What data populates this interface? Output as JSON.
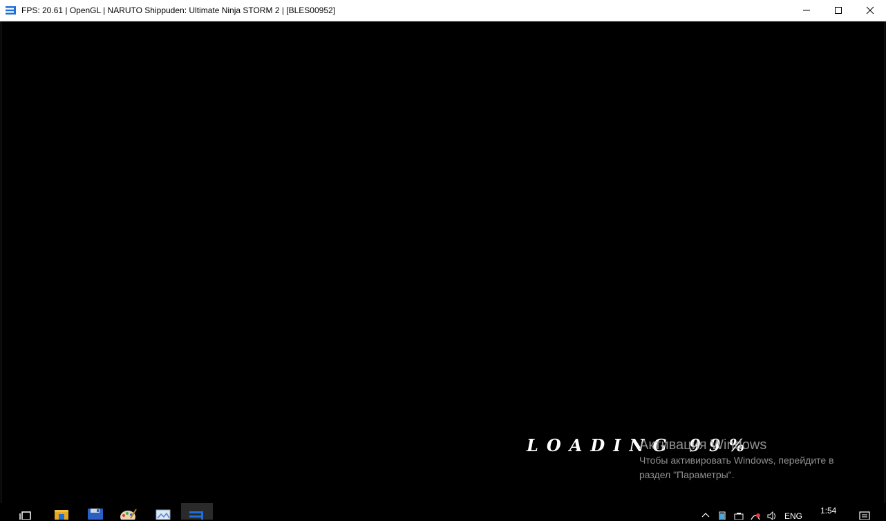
{
  "window": {
    "title": "FPS: 20.61 | OpenGL | NARUTO Shippuden: Ultimate Ninja STORM 2 | [BLES00952]",
    "icon": "rpcs3-icon",
    "controls": [
      "minimize-icon",
      "maximize-icon",
      "close-icon"
    ]
  },
  "game": {
    "loading_text": "LOADING 99%",
    "loading_progress_percent": 99
  },
  "watermark": {
    "title": "Активация Windows",
    "line1": "Чтобы активировать Windows, перейдите в",
    "line2": "раздел \"Параметры\"."
  },
  "taskbar": {
    "pinned": [
      "task-view-icon",
      "file-explorer-icon",
      "save-disk-icon",
      "paint-icon",
      "image-viewer-icon",
      "rpcs3-taskbar-icon"
    ],
    "tray": {
      "language": "ENG",
      "time": "1:54"
    }
  },
  "colors": {
    "accent": "#1e6fd9",
    "titlebar_bg": "#ffffff",
    "game_bg": "#000000"
  }
}
